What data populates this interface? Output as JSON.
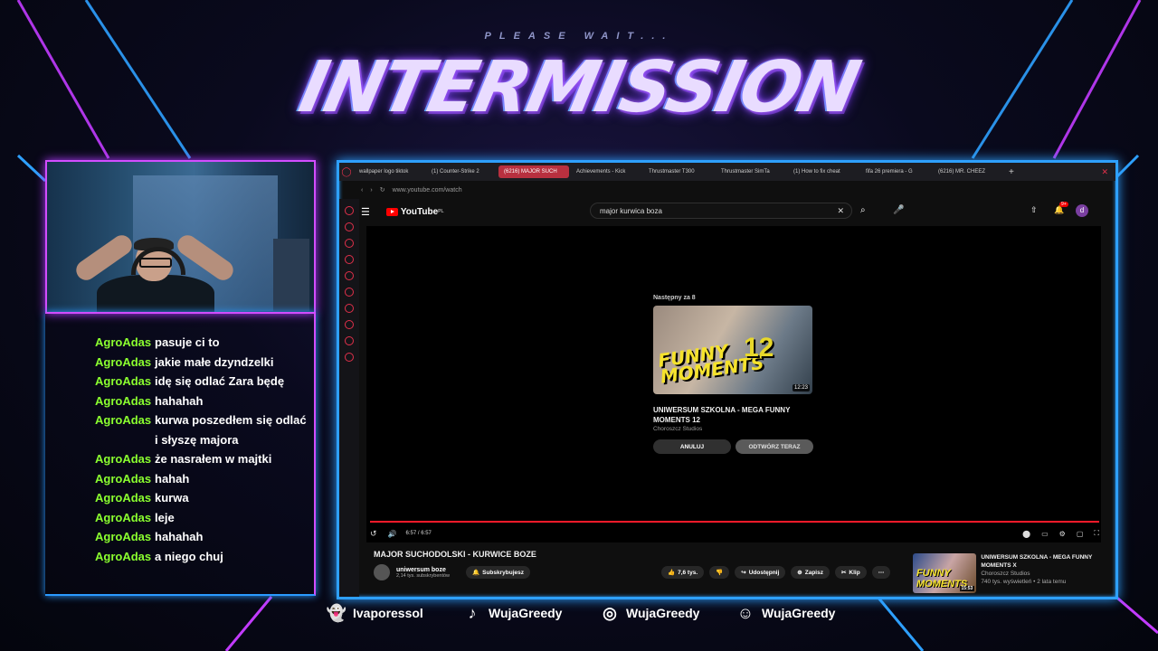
{
  "overlay": {
    "please_wait": "PLEASE WAIT...",
    "title": "INTERMISSION",
    "accent_pink": "#d24dff",
    "accent_blue": "#2ea0ff"
  },
  "chat": {
    "messages": [
      {
        "user": "AgroAdas",
        "text": "pasuje ci to"
      },
      {
        "user": "AgroAdas",
        "text": "jakie małe dzyndzelki"
      },
      {
        "user": "AgroAdas",
        "text": "idę się odlać Zara będę"
      },
      {
        "user": "AgroAdas",
        "text": "hahahah"
      },
      {
        "user": "AgroAdas",
        "text": "kurwa poszedłem się odlać i słyszę majora"
      },
      {
        "user": "AgroAdas",
        "text": "że nasrałem w majtki"
      },
      {
        "user": "AgroAdas",
        "text": "hahah"
      },
      {
        "user": "AgroAdas",
        "text": "kurwa"
      },
      {
        "user": "AgroAdas",
        "text": "leje"
      },
      {
        "user": "AgroAdas",
        "text": "hahahah"
      },
      {
        "user": "AgroAdas",
        "text": "a niego chuj"
      }
    ]
  },
  "browser": {
    "tabs": [
      {
        "label": "wallpaper logo tiktok",
        "active": false
      },
      {
        "label": "(1) Counter-Strike 2",
        "active": false
      },
      {
        "label": "(6216) MAJOR SUCH",
        "active": true
      },
      {
        "label": "Achievements - Kick",
        "active": false
      },
      {
        "label": "Thrustmaster T300",
        "active": false
      },
      {
        "label": "Thrustmaster SimTa",
        "active": false
      },
      {
        "label": "(1) How to fix cheat",
        "active": false
      },
      {
        "label": "fifa 26 premiera - G",
        "active": false
      },
      {
        "label": "(6216) MR. CHEEZ",
        "active": false
      }
    ],
    "url": "www.youtube.com/watch"
  },
  "youtube": {
    "logo": "YouTube",
    "logo_region": "PL",
    "search_value": "major kurwica boza",
    "avatar_letter": "d",
    "notif_count": "9+",
    "up_next": {
      "label": "Następny za 8",
      "thumb_text": "FUNNY MOMENTS",
      "thumb_number": "12",
      "duration": "12:23",
      "title": "UNIWERSUM SZKOLNA - MEGA FUNNY MOMENTS 12",
      "channel": "Choroszcz Studios",
      "cancel": "ANULUJ",
      "play_now": "ODTWÓRZ TERAZ"
    },
    "controls": {
      "time": "6:57 / 6:57",
      "progress": 1.0
    },
    "video": {
      "title": "MAJOR SUCHODOLSKI - KURWICE BOZE",
      "channel": "uniwersum boze",
      "subs": "2,14 tys. subskrybentów",
      "subscribe": "Subskrybujesz",
      "likes": "7,6 tys.",
      "share": "Udostępnij",
      "save": "Zapisz",
      "clip": "Klip"
    },
    "recommended": {
      "title": "UNIWERSUM SZKOLNA - MEGA FUNNY MOMENTS X",
      "channel": "Choroszcz Studios",
      "meta": "740 tys. wyświetleń • 2 lata temu",
      "duration": "15:53",
      "thumb_text": "FUNNY MOMENTS"
    }
  },
  "socials": [
    {
      "icon": "snapchat-icon",
      "handle": "Ivaporessol"
    },
    {
      "icon": "tiktok-icon",
      "handle": "WujaGreedy"
    },
    {
      "icon": "instagram-icon",
      "handle": "WujaGreedy"
    },
    {
      "icon": "discord-icon",
      "handle": "WujaGreedy"
    }
  ]
}
